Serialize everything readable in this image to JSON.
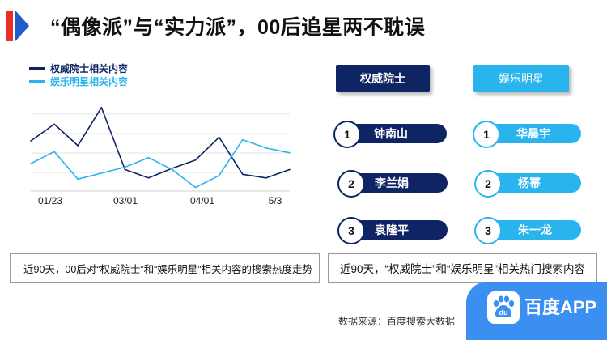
{
  "title": "“偶像派”与“实力派”，00后追星两不耽误",
  "colors": {
    "academic": "#0e2463",
    "star": "#2ab4ee",
    "title_red": "#e8302b",
    "title_blue": "#1f5ec9",
    "app_blue": "#3a8ff0"
  },
  "chart_data": {
    "type": "line",
    "x_ticks": [
      "01/23",
      "03/01",
      "04/01",
      "5/3"
    ],
    "y_axis": "unlabeled",
    "grid": true,
    "legend_position": "top-left",
    "series": [
      {
        "name": "权威院士相关内容",
        "color": "#0e2463",
        "values": [
          42,
          56,
          38,
          70,
          18,
          11,
          19,
          26,
          45,
          14,
          11,
          18
        ]
      },
      {
        "name": "娱乐明星相关内容",
        "color": "#2ab4ee",
        "values": [
          23,
          33,
          10,
          15,
          20,
          28,
          18,
          3,
          13,
          43,
          36,
          32
        ]
      }
    ]
  },
  "captions": {
    "left": "近90天，00后对“权威院士”和“娱乐明星”相关内容的搜索热度走势",
    "right": "近90天，“权威院士”和“娱乐明星”相关热门搜索内容"
  },
  "rankings": {
    "academic_header": "权威院士",
    "star_header": "娱乐明星",
    "academic": [
      {
        "rank": "1",
        "name": "钟南山"
      },
      {
        "rank": "2",
        "name": "李兰娟"
      },
      {
        "rank": "3",
        "name": "袁隆平"
      }
    ],
    "star": [
      {
        "rank": "1",
        "name": "华晨宇"
      },
      {
        "rank": "2",
        "name": "杨幂"
      },
      {
        "rank": "3",
        "name": "朱一龙"
      }
    ]
  },
  "source": "数据来源：百度搜索大数据",
  "app": {
    "name": "百度APP",
    "logo_text": "du"
  }
}
